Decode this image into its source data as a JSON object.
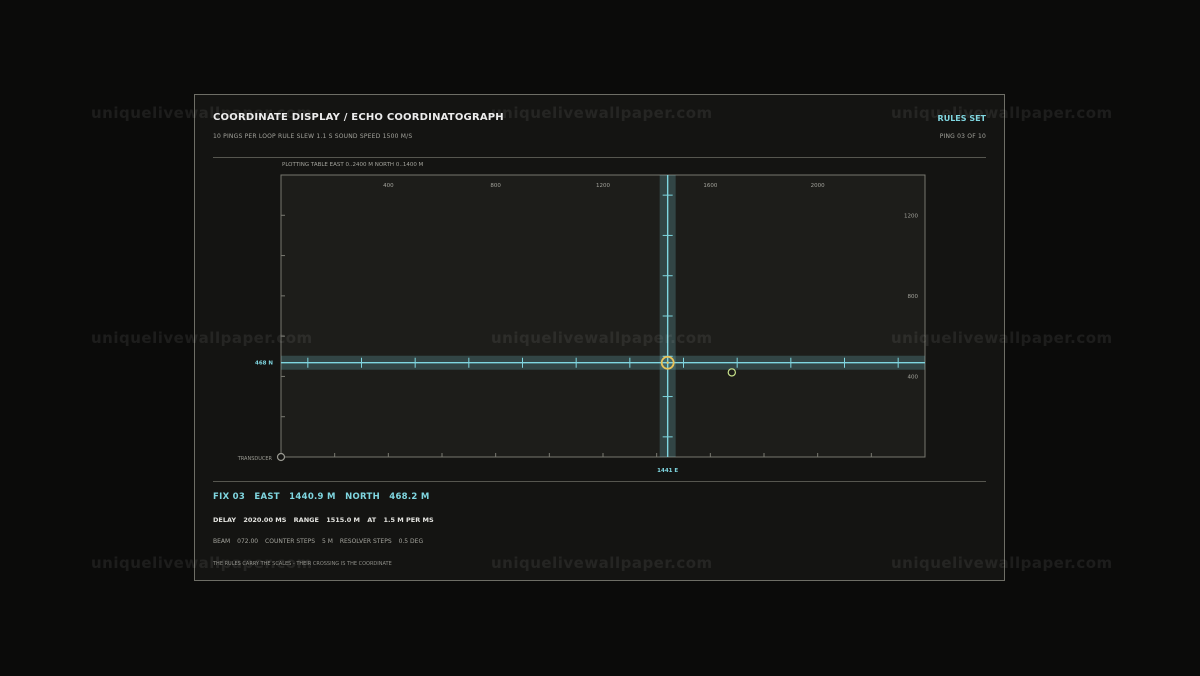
{
  "header": {
    "title": "COORDINATE DISPLAY / ECHO COORDINATOGRAPH",
    "status": "RULES SET",
    "params": "10 PINGS PER LOOP   RULE SLEW 1.1 S   SOUND SPEED 1500 M/S",
    "ping_counter": "PING 03 OF 10"
  },
  "plotting_table": {
    "caption": "PLOTTING TABLE   EAST 0..2400 M   NORTH 0..1400 M",
    "east_range_m": [
      0,
      2400
    ],
    "north_range_m": [
      0,
      1400
    ],
    "east_tick_labels": [
      {
        "value": 400,
        "label": "400"
      },
      {
        "value": 800,
        "label": "800"
      },
      {
        "value": 1200,
        "label": "1200"
      },
      {
        "value": 1600,
        "label": "1600"
      },
      {
        "value": 2000,
        "label": "2000"
      }
    ],
    "north_tick_labels": [
      {
        "value": 400,
        "label": "400"
      },
      {
        "value": 800,
        "label": "800"
      },
      {
        "value": 1200,
        "label": "1200"
      }
    ],
    "east_rule": {
      "value_m": 1441,
      "label": "1441 E"
    },
    "north_rule": {
      "value_m": 468,
      "label": "468 N"
    },
    "transducer_label": "TRANSDUCER",
    "previous_fix": {
      "east_m": 1680,
      "north_m": 420
    },
    "accent_color": "#7fd6e0",
    "fix_color": "#e8c25a",
    "previous_fix_color": "#c8e28a"
  },
  "fix": {
    "label": "FIX 03",
    "east_label": "EAST",
    "east_value": "1440.9 M",
    "north_label": "NORTH",
    "north_value": "468.2 M"
  },
  "delay": {
    "delay_label": "DELAY",
    "delay_value": "2020.00 MS",
    "range_label": "RANGE",
    "range_value": "1515.0 M",
    "at_label": "AT",
    "at_value": "1.5 M PER MS"
  },
  "beam": {
    "beam_label": "BEAM",
    "beam_value": "072.00",
    "counter_label": "COUNTER STEPS",
    "counter_value": "5 M",
    "resolver_label": "RESOLVER STEPS",
    "resolver_value": "0.5 DEG"
  },
  "footer_note": "THE RULES CARRY THE SCALES - THEIR CROSSING IS THE COORDINATE",
  "watermark": "uniquelivewallpaper.com"
}
